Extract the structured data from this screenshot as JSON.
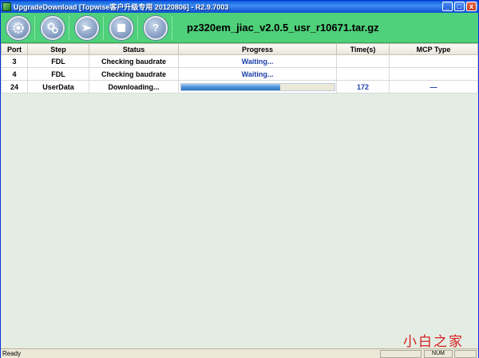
{
  "window": {
    "title": "UpgradeDownload [Topwise客户升级专用 20120806] - R2.9.7003"
  },
  "title_buttons": {
    "minimize": "_",
    "maximize": "□",
    "close": "x"
  },
  "toolbar": {
    "buttons": [
      {
        "icon": "gear-icon",
        "label": ""
      },
      {
        "icon": "settings-gears-icon",
        "label": ""
      },
      {
        "icon": "play-arrow-icon",
        "label": ""
      },
      {
        "icon": "stop-icon",
        "label": ""
      },
      {
        "icon": "help-icon",
        "label": "?"
      }
    ],
    "package_name": "pz320em_jiac_v2.0.5_usr_r10671.tar.gz"
  },
  "grid": {
    "columns": [
      "Port",
      "Step",
      "Status",
      "Progress",
      "Time(s)",
      "MCP Type"
    ],
    "rows": [
      {
        "port": "3",
        "step": "FDL",
        "status": "Checking baudrate",
        "progress_text": "Waiting...",
        "progress_fraction": null,
        "time": "",
        "mcp": ""
      },
      {
        "port": "4",
        "step": "FDL",
        "status": "Checking baudrate",
        "progress_text": "Waiting...",
        "progress_fraction": null,
        "time": "",
        "mcp": ""
      },
      {
        "port": "24",
        "step": "UserData",
        "status": "Downloading...",
        "progress_text": "",
        "progress_fraction": 0.65,
        "time": "172",
        "mcp": "—"
      }
    ]
  },
  "watermark": "小白之家",
  "statusbar": {
    "text": "Ready",
    "num": "NUM"
  },
  "colors": {
    "toolbar_bg": "#4fd07a",
    "grid_bg": "#e4ede4",
    "progress_fill": "#4a90d9",
    "text_blue": "#1a3fa8",
    "watermark": "#d42020"
  }
}
